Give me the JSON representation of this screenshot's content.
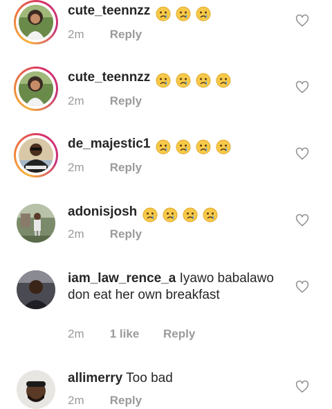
{
  "comments": [
    {
      "username": "cute_teennzz",
      "text": "",
      "emoji_count": 3,
      "time": "2m",
      "likes": "",
      "reply": "Reply",
      "avatar": "ring-girl"
    },
    {
      "username": "cute_teennzz",
      "text": "",
      "emoji_count": 4,
      "time": "2m",
      "likes": "",
      "reply": "Reply",
      "avatar": "ring-girl"
    },
    {
      "username": "de_majestic1",
      "text": "",
      "emoji_count": 4,
      "time": "2m",
      "likes": "",
      "reply": "Reply",
      "avatar": "ring-sunglasses"
    },
    {
      "username": "adonisjosh",
      "text": "",
      "emoji_count": 4,
      "time": "2m",
      "likes": "",
      "reply": "Reply",
      "avatar": "outdoor-man"
    },
    {
      "username": "iam_law_rence_a",
      "text": "Iyawo babalawo don eat her own breakfast",
      "emoji_count": 0,
      "time": "2m",
      "likes": "1 like",
      "reply": "Reply",
      "avatar": "dark-man"
    },
    {
      "username": "allimerry",
      "text": "Too bad",
      "emoji_count": 0,
      "time": "2m",
      "likes": "",
      "reply": "Reply",
      "avatar": "bearded-man"
    }
  ],
  "icons": {
    "emoji": "crying-face-emoji",
    "like": "heart-outline-icon"
  },
  "colors": {
    "ring_start": "#f6b23c",
    "ring_end": "#c8347a",
    "meta_text": "#9a9a9a",
    "username": "#262626"
  }
}
